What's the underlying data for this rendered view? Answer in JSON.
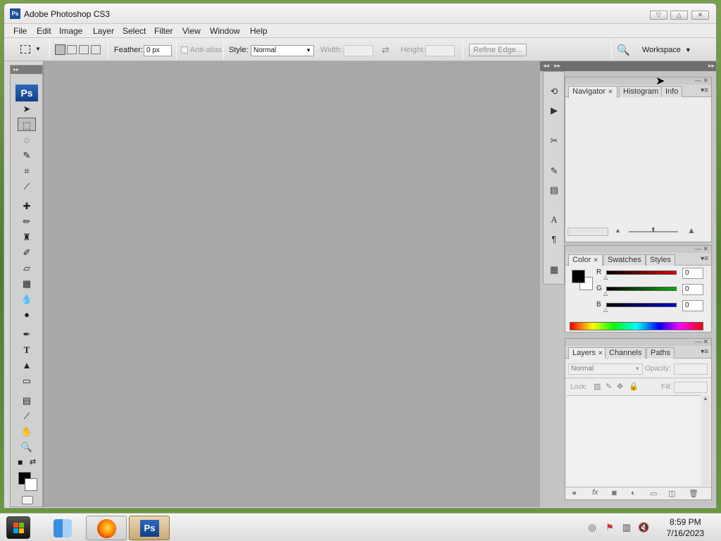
{
  "window": {
    "title": "Adobe Photoshop CS3",
    "app_icon": "Ps"
  },
  "menu": [
    "File",
    "Edit",
    "Image",
    "Layer",
    "Select",
    "Filter",
    "View",
    "Window",
    "Help"
  ],
  "options": {
    "feather_label": "Feather:",
    "feather_value": "0 px",
    "antialias_label": "Anti-alias",
    "style_label": "Style:",
    "style_value": "Normal",
    "width_label": "Width:",
    "height_label": "Height:",
    "refine_edge": "Refine Edge...",
    "workspace": "Workspace"
  },
  "toolbox": {
    "logo": "Ps"
  },
  "navigator_panel": {
    "tabs": [
      "Navigator",
      "Histogram",
      "Info"
    ]
  },
  "color_panel": {
    "tabs": [
      "Color",
      "Swatches",
      "Styles"
    ],
    "channels": [
      {
        "label": "R",
        "value": "0",
        "color": "#e00000"
      },
      {
        "label": "G",
        "value": "0",
        "color": "#00b000"
      },
      {
        "label": "B",
        "value": "0",
        "color": "#0000d0"
      }
    ]
  },
  "layers_panel": {
    "tabs": [
      "Layers",
      "Channels",
      "Paths"
    ],
    "blend_mode": "Normal",
    "opacity_label": "Opacity:",
    "lock_label": "Lock:",
    "fill_label": "Fill:"
  },
  "taskbar": {
    "time": "8:59 PM",
    "date": "7/16/2023",
    "ps_label": "Ps"
  }
}
